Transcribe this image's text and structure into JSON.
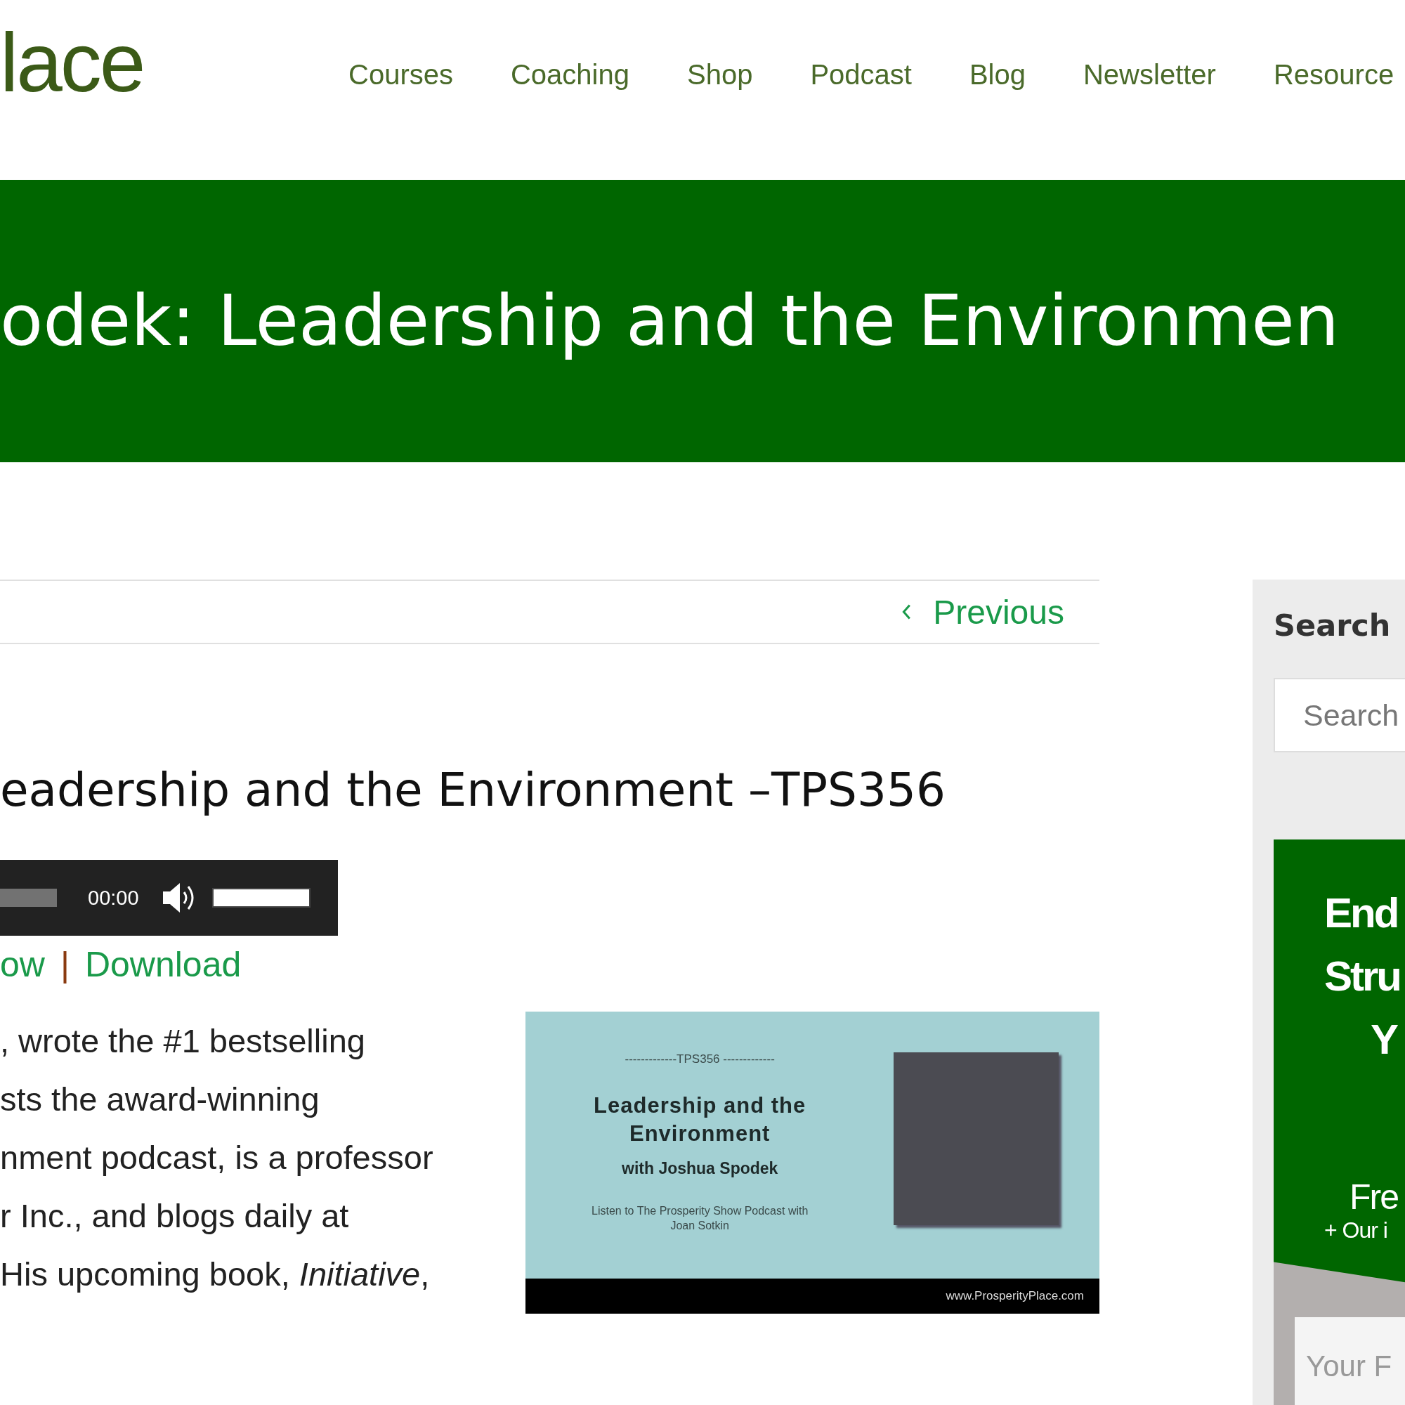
{
  "header": {
    "logo": "lace",
    "nav": [
      {
        "label": "Courses"
      },
      {
        "label": "Coaching"
      },
      {
        "label": "Shop"
      },
      {
        "label": "Podcast"
      },
      {
        "label": "Blog"
      },
      {
        "label": "Newsletter"
      },
      {
        "label": "Resource"
      }
    ]
  },
  "banner": {
    "title": "odek: Leadership and the Environmen"
  },
  "post_nav": {
    "previous": "Previous"
  },
  "post": {
    "title": "eadership and the Environment –TPS356",
    "player": {
      "time": "00:00",
      "volume": {
        "level": 1
      }
    },
    "links": [
      {
        "label": "ow"
      },
      {
        "label": "Download"
      }
    ],
    "separator": "|",
    "paragraph": [
      ", wrote the #1 bestselling",
      "sts the award-winning",
      "nment podcast, is a professor",
      "r Inc., and blogs daily at",
      "His upcoming book, *Initiative*,"
    ],
    "promo_image": {
      "episode": "-------------TPS356 -------------",
      "title": "Leadership and the Environment",
      "guest": "with Joshua Spodek",
      "listen": "Listen to The Prosperity Show Podcast with Joan Sotkin",
      "url": "www.ProsperityPlace.com"
    }
  },
  "sidebar": {
    "search_heading": "Search",
    "search": {
      "placeholder": "Search"
    },
    "promo": {
      "headline": [
        "End",
        "Stru",
        "Y"
      ],
      "offer": "Fre",
      "offer_note": "+ Our i",
      "input": {
        "placeholder": "Your F"
      }
    }
  }
}
